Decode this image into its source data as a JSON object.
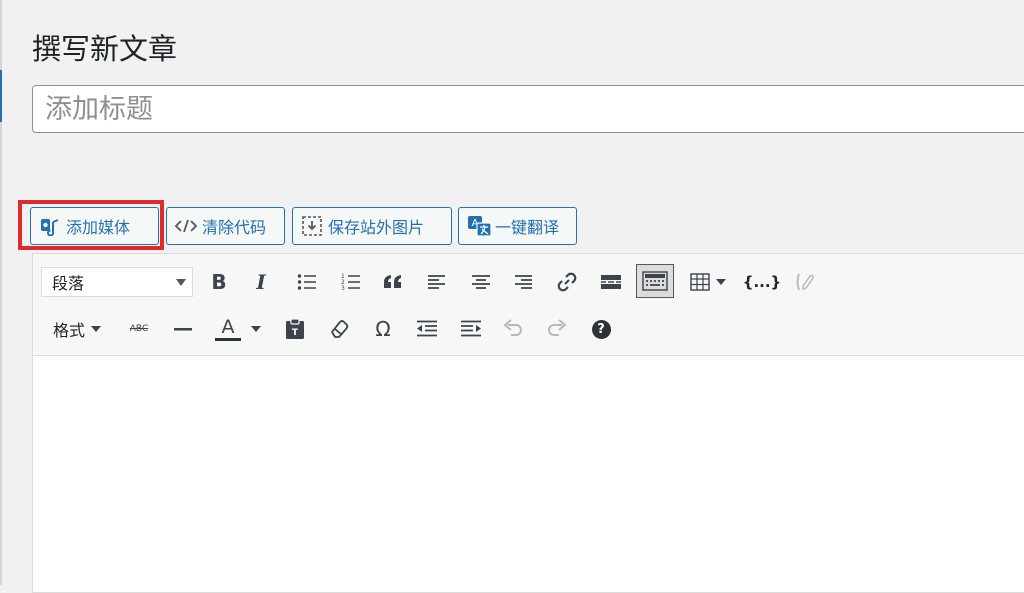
{
  "page": {
    "title": "撰写新文章"
  },
  "title_input": {
    "placeholder": "添加标题",
    "value": ""
  },
  "media_buttons": [
    {
      "label": "添加媒体",
      "icon": "add-media-icon"
    },
    {
      "label": "清除代码",
      "icon": "code-icon"
    },
    {
      "label": "保存站外图片",
      "icon": "save-download-icon"
    },
    {
      "label": "一键翻译",
      "icon": "translate-icon"
    }
  ],
  "toolbar": {
    "format_select": {
      "selected": "段落"
    },
    "row1": [
      "bold",
      "italic",
      "bulleted-list",
      "numbered-list",
      "blockquote",
      "align-left",
      "align-center",
      "align-right",
      "insert-link",
      "read-more",
      "toolbar-toggle",
      "table",
      "code-block",
      "unlink"
    ],
    "row2": {
      "formats_label": "格式",
      "bold_text": "B",
      "italic_text": "I",
      "strike_text": "ABC",
      "text_color_text": "A",
      "omega_text": "Ω",
      "help_text": "?",
      "code_text": "{...}"
    }
  },
  "colors": {
    "accent": "#2271b1",
    "highlight": "#e02b2b",
    "text": "#1d2327",
    "background": "#f1f1f1"
  }
}
